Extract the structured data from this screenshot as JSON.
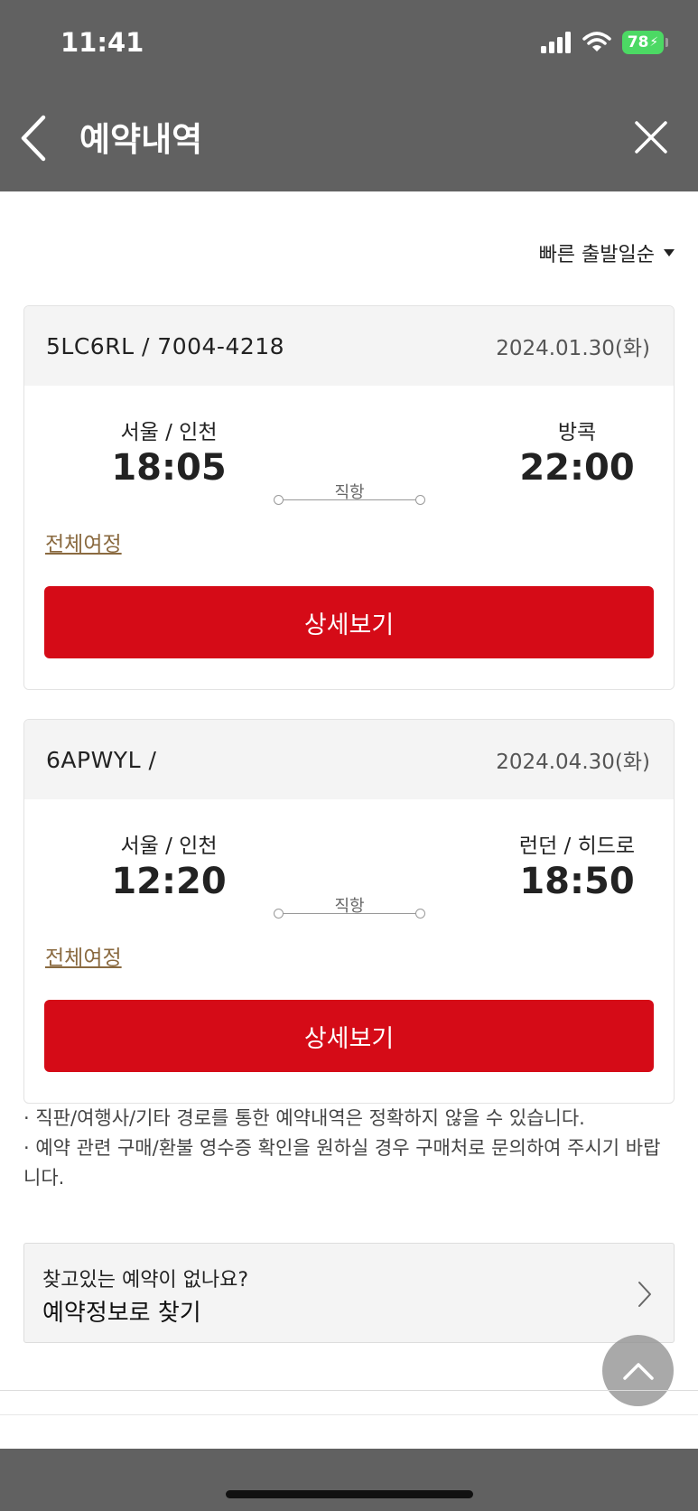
{
  "status": {
    "time": "11:41",
    "battery": "78"
  },
  "nav": {
    "title": "예약내역"
  },
  "sort": {
    "label": "빠른 출발일순"
  },
  "bookings": [
    {
      "code": "5LC6RL / 7004-4218",
      "date": "2024.01.30(화)",
      "dep_city": "서울 / 인천",
      "dep_time": "18:05",
      "arr_city": "방콕",
      "arr_time": "22:00",
      "route_type": "직항",
      "full_trip": "전체여정",
      "detail_label": "상세보기"
    },
    {
      "code": "6APWYL /",
      "date": "2024.04.30(화)",
      "dep_city": "서울 / 인천",
      "dep_time": "12:20",
      "arr_city": "런던 / 히드로",
      "arr_time": "18:50",
      "route_type": "직항",
      "full_trip": "전체여정",
      "detail_label": "상세보기"
    }
  ],
  "notes": [
    "· 직판/여행사/기타 경로를 통한 예약내역은 정확하지 않을 수 있습니다.",
    "· 예약 관련 구매/환불 영수증 확인을 원하실 경우 구매처로 문의하여 주시기 바랍니다."
  ],
  "find": {
    "question": "찾고있는 예약이 없나요?",
    "link": "예약정보로 찾기"
  },
  "colors": {
    "header": "#616161",
    "primary_button": "#d50b17",
    "link_brown": "#8a6a40",
    "battery": "#4cd964"
  }
}
